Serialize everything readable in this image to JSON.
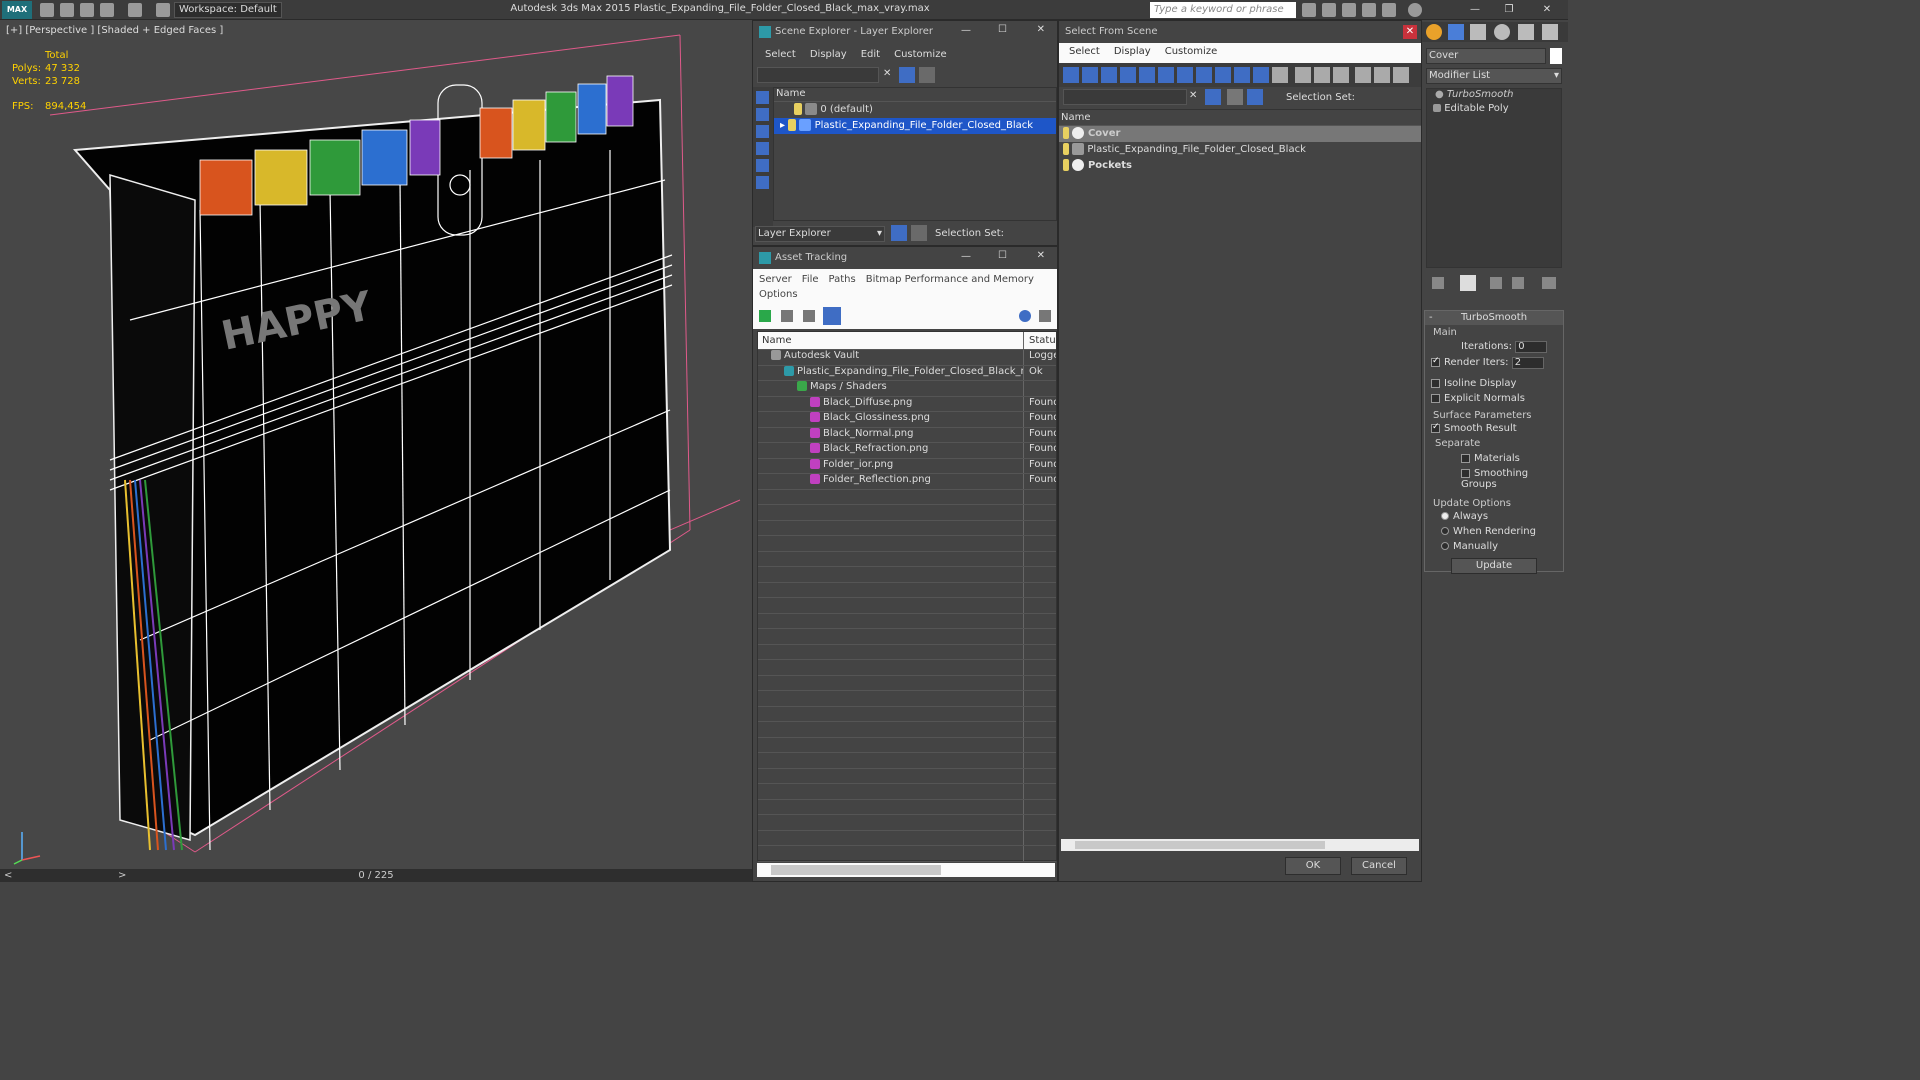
{
  "app": {
    "logo": "MAX",
    "title": "Autodesk 3ds Max  2015     Plastic_Expanding_File_Folder_Closed_Black_max_vray.max",
    "workspace": "Workspace: Default",
    "search_placeholder": "Type a keyword or phrase"
  },
  "viewport": {
    "label": "[+] [Perspective ] [Shaded + Edged Faces ]",
    "total_label": "Total",
    "polys_label": "Polys:",
    "polys": "47 332",
    "verts_label": "Verts:",
    "verts": "23 728",
    "fps_label": "FPS:",
    "fps": "894,454",
    "model_text": "HAPPY",
    "frame": "0 / 225"
  },
  "scene_explorer": {
    "title": "Scene Explorer - Layer Explorer",
    "menu": [
      "Select",
      "Display",
      "Edit",
      "Customize"
    ],
    "col_name": "Name",
    "rows": [
      "0 (default)",
      "Plastic_Expanding_File_Folder_Closed_Black"
    ],
    "layer_dropdown": "Layer Explorer",
    "selection_set": "Selection Set:"
  },
  "asset_tracking": {
    "title": "Asset Tracking",
    "menu": [
      "Server",
      "File",
      "Paths",
      "Bitmap Performance and Memory"
    ],
    "menu2": "Options",
    "col_name": "Name",
    "col_status": "Status",
    "rows": [
      {
        "name": "Autodesk Vault",
        "status": "Logge",
        "indent": 1
      },
      {
        "name": "Plastic_Expanding_File_Folder_Closed_Black_ma...",
        "status": "Ok",
        "indent": 2
      },
      {
        "name": "Maps / Shaders",
        "status": "",
        "indent": 3
      },
      {
        "name": "Black_Diffuse.png",
        "status": "Found",
        "indent": 4
      },
      {
        "name": "Black_Glossiness.png",
        "status": "Found",
        "indent": 4
      },
      {
        "name": "Black_Normal.png",
        "status": "Found",
        "indent": 4
      },
      {
        "name": "Black_Refraction.png",
        "status": "Found",
        "indent": 4
      },
      {
        "name": "Folder_ior.png",
        "status": "Found",
        "indent": 4
      },
      {
        "name": "Folder_Reflection.png",
        "status": "Found",
        "indent": 4
      }
    ]
  },
  "select_from_scene": {
    "title": "Select From Scene",
    "menu": [
      "Select",
      "Display",
      "Customize"
    ],
    "selection_set": "Selection Set:",
    "col_name": "Name",
    "rows": [
      "Cover",
      "Plastic_Expanding_File_Folder_Closed_Black",
      "Pockets"
    ],
    "ok": "OK",
    "cancel": "Cancel"
  },
  "command_panel": {
    "object_name": "Cover",
    "modifier_list": "Modifier List",
    "stack": [
      "TurboSmooth",
      "Editable Poly"
    ],
    "rollout": "TurboSmooth",
    "main": "Main",
    "iterations_label": "Iterations:",
    "iterations": "0",
    "render_iters_label": "Render Iters:",
    "render_iters": "2",
    "isoline": "Isoline Display",
    "explicit": "Explicit Normals",
    "surface": "Surface Parameters",
    "smooth_result": "Smooth Result",
    "separate": "Separate",
    "materials": "Materials",
    "smoothing_groups": "Smoothing Groups",
    "update_options": "Update Options",
    "always": "Always",
    "when_rendering": "When Rendering",
    "manually": "Manually",
    "update": "Update"
  },
  "colors": {
    "accent": "#3f6dc4",
    "selection": "#1e56c8",
    "stats": "#ffd200"
  }
}
